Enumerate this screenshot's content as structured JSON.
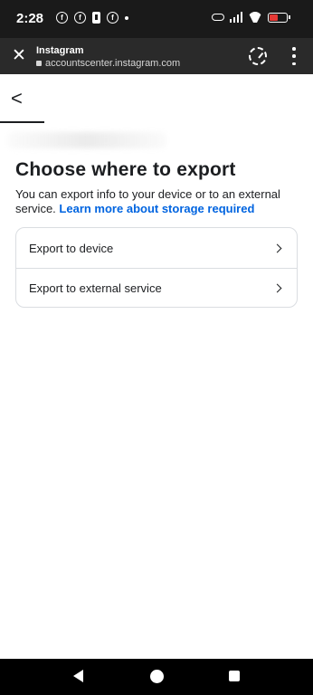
{
  "status_bar": {
    "time": "2:28",
    "left_icons": [
      "facebook-icon",
      "facebook-icon",
      "battery-saver-icon",
      "facebook-icon",
      "dot-icon"
    ],
    "right_icons": [
      "key-icon",
      "signal-icon",
      "wifi-icon",
      "battery-icon"
    ],
    "battery_color": "#e53935"
  },
  "browser": {
    "title": "Instagram",
    "url": "accountscenter.instagram.com"
  },
  "page": {
    "title": "Choose where to export",
    "description": "You can export info to your device or to an external service.",
    "learn_more": "Learn more about storage required",
    "link_color": "#0064e0",
    "options": [
      {
        "label": "Export to device"
      },
      {
        "label": "Export to external service"
      }
    ]
  }
}
